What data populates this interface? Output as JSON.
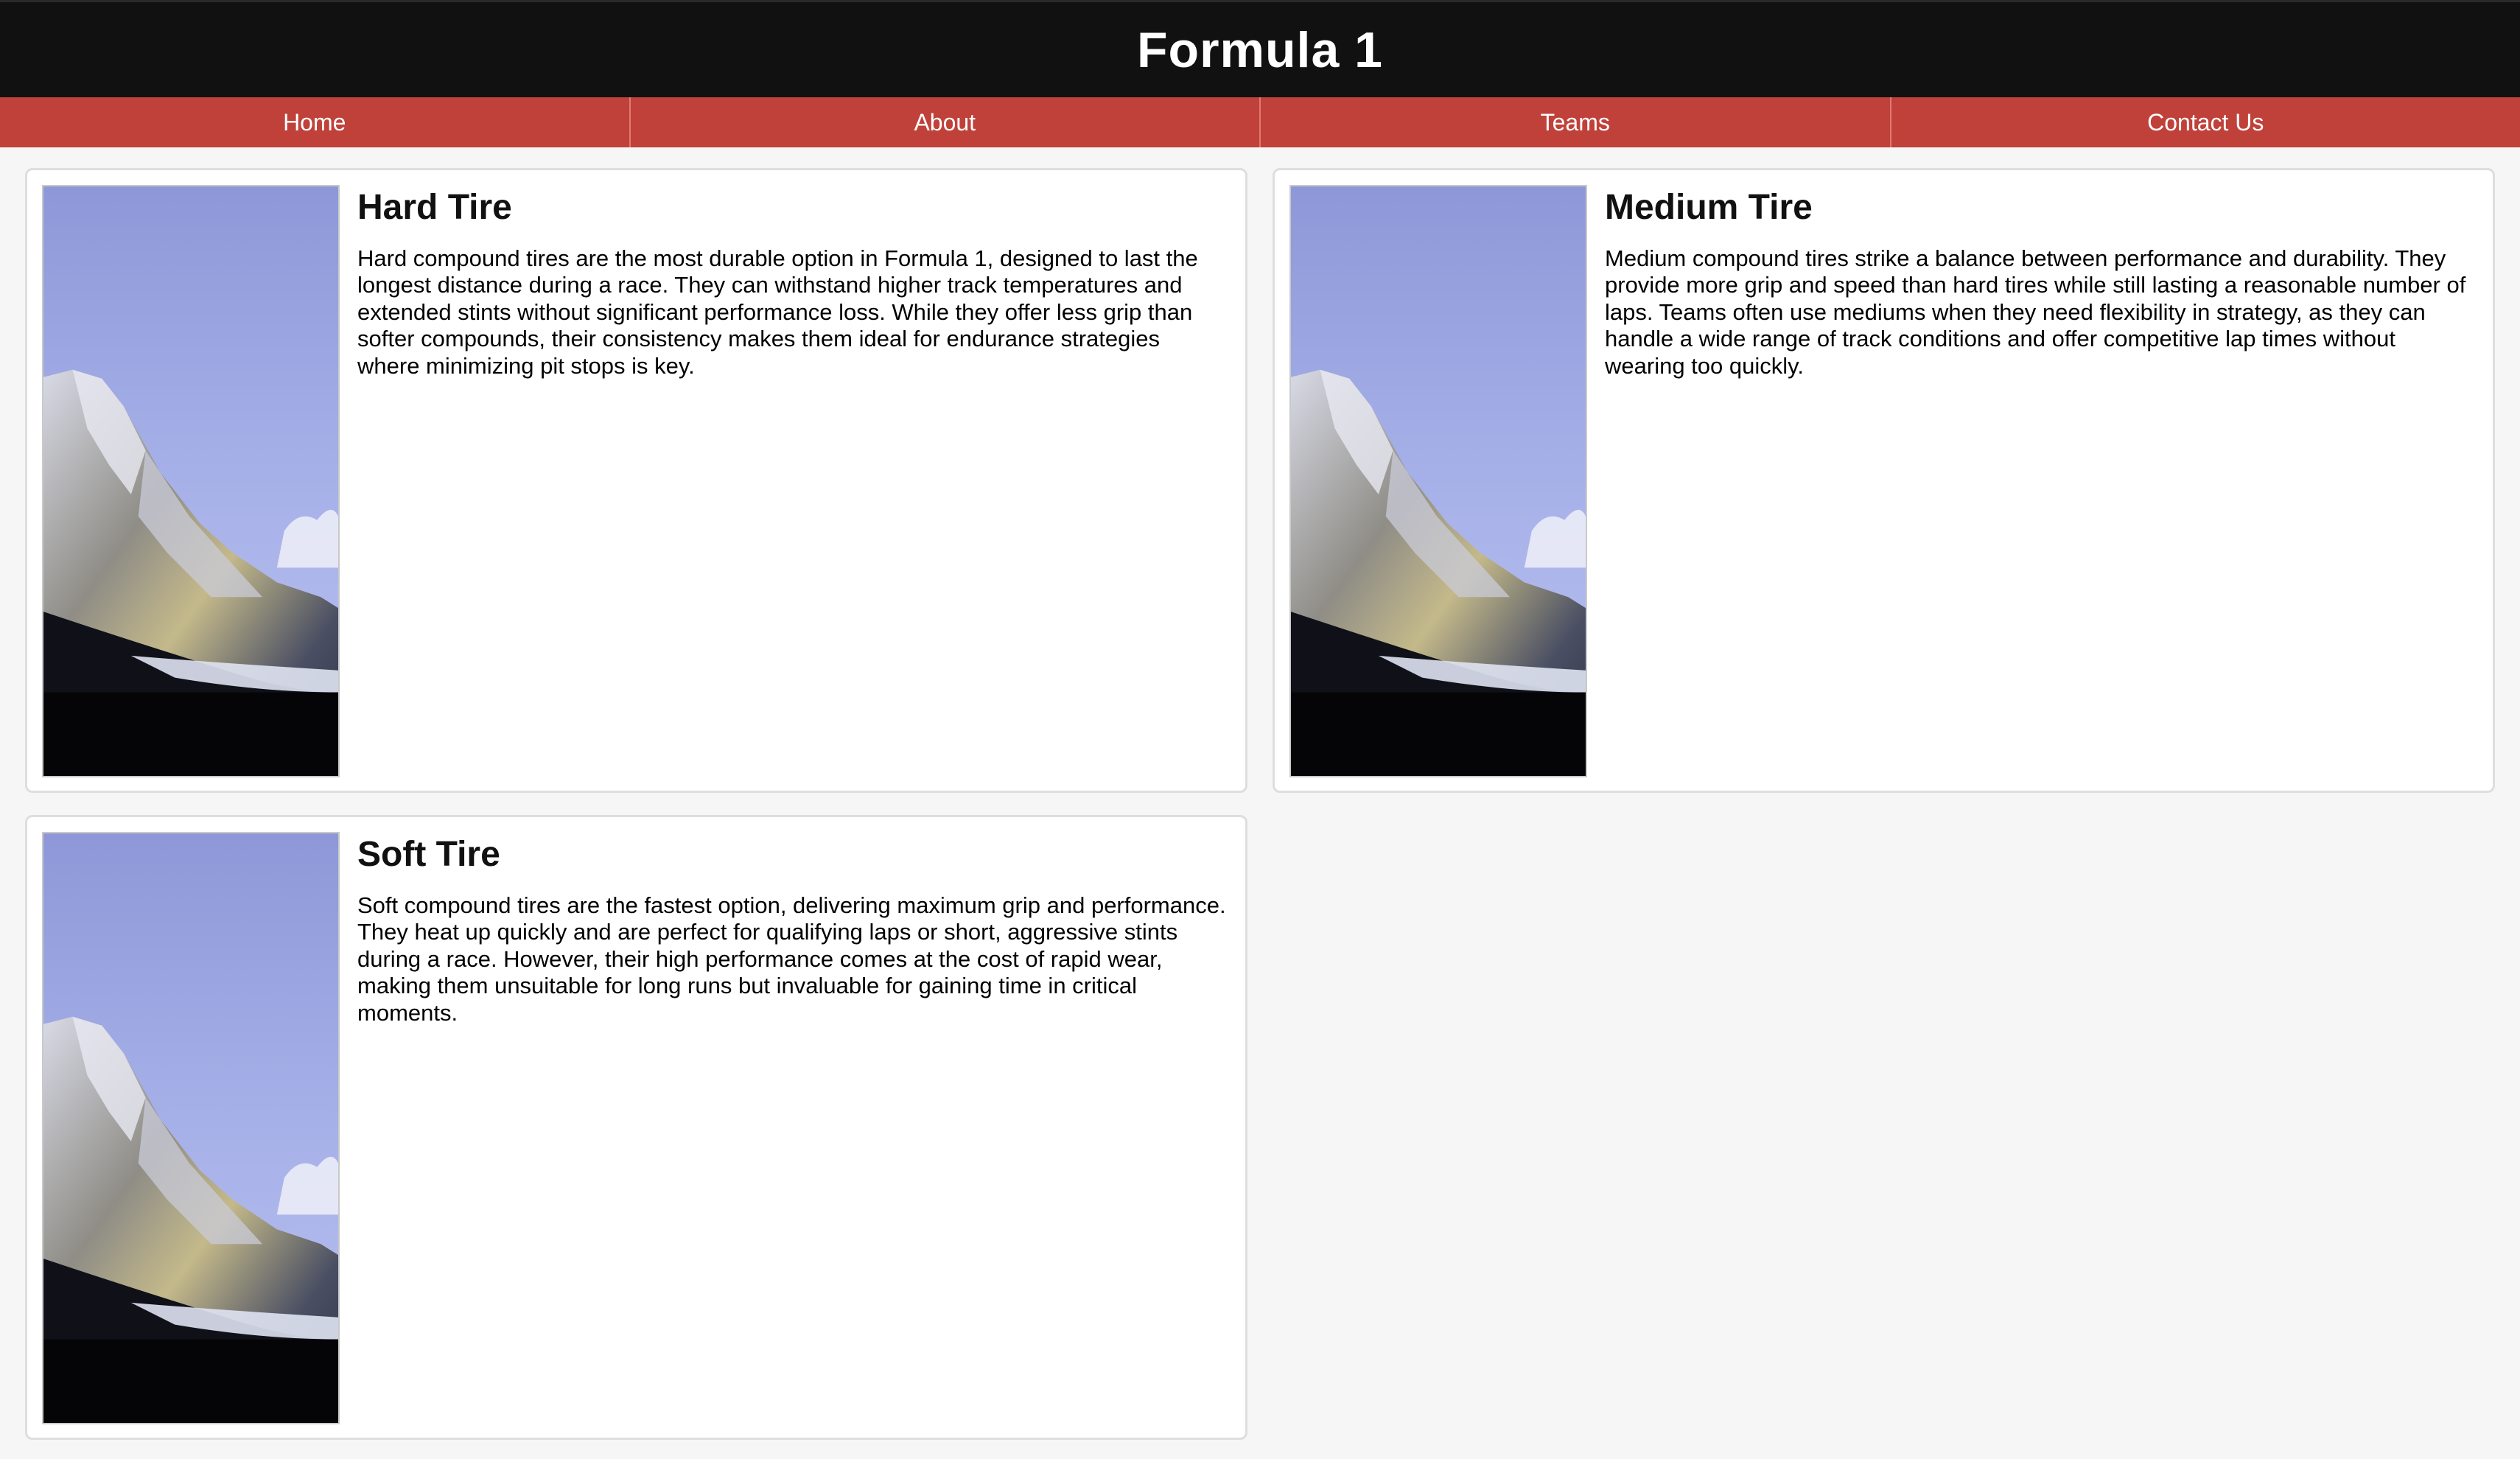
{
  "site": {
    "title": "Formula 1"
  },
  "nav": {
    "items": [
      {
        "label": "Home"
      },
      {
        "label": "About"
      },
      {
        "label": "Teams"
      },
      {
        "label": "Contact Us"
      }
    ]
  },
  "cards": [
    {
      "title": "Hard Tire",
      "text": "Hard compound tires are the most durable option in Formula 1, designed to last the longest distance during a race. They can withstand higher track temperatures and extended stints without significant performance loss. While they offer less grip than softer compounds, their consistency makes them ideal for endurance strategies where minimizing pit stops is key.",
      "image_icon": "mountain-photo"
    },
    {
      "title": "Medium Tire",
      "text": "Medium compound tires strike a balance between performance and durability. They provide more grip and speed than hard tires while still lasting a reasonable number of laps. Teams often use mediums when they need flexibility in strategy, as they can handle a wide range of track conditions and offer competitive lap times without wearing too quickly.",
      "image_icon": "mountain-photo"
    },
    {
      "title": "Soft Tire",
      "text": "Soft compound tires are the fastest option, delivering maximum grip and performance. They heat up quickly and are perfect for qualifying laps or short, aggressive stints during a race. However, their high performance comes at the cost of rapid wear, making them unsuitable for long runs but invaluable for gaining time in critical moments.",
      "image_icon": "mountain-photo"
    }
  ],
  "colors": {
    "header_bg": "#111111",
    "nav_bg": "#c0413a",
    "page_bg": "#f6f6f6"
  }
}
